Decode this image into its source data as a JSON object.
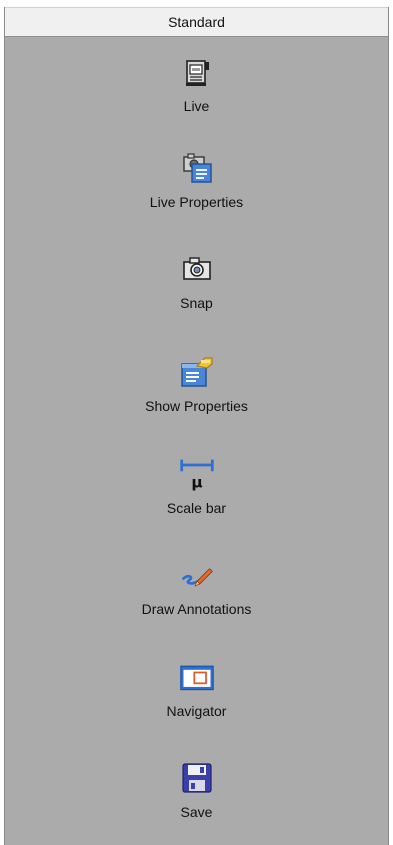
{
  "toolbar": {
    "title": "Standard",
    "items": [
      {
        "label": "Live",
        "icon": "video-camera-icon"
      },
      {
        "label": "Live Properties",
        "icon": "camera-properties-icon"
      },
      {
        "label": "Snap",
        "icon": "camera-icon"
      },
      {
        "label": "Show Properties",
        "icon": "properties-pointer-icon"
      },
      {
        "label": "Scale bar",
        "icon": "scale-bar-icon"
      },
      {
        "label": "Draw Annotations",
        "icon": "pencil-draw-icon"
      },
      {
        "label": "Navigator",
        "icon": "navigator-window-icon"
      },
      {
        "label": "Save",
        "icon": "floppy-disk-icon"
      }
    ]
  },
  "colors": {
    "panel_bg": "#ababab",
    "header_bg": "#f0f0f0",
    "accent_blue": "#2f6fd0",
    "accent_orange": "#e36a2f"
  }
}
